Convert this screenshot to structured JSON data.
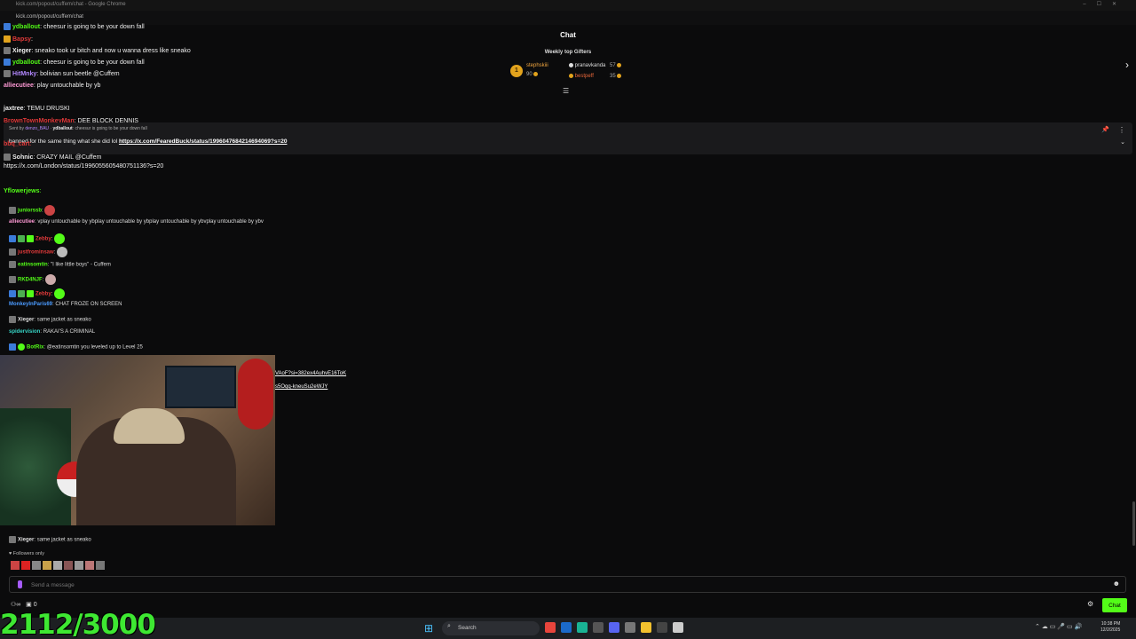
{
  "window": {
    "title": "kick.com/popout/cuffem/chat - Google Chrome",
    "url": "kick.com/popout/cuffem/chat"
  },
  "header": {
    "title": "Chat",
    "gifters_title": "Weekly top Gifters",
    "gifters": [
      {
        "rank": "1",
        "name": "stephskiii",
        "count": "90"
      },
      {
        "name": "pranavkanda",
        "count": "57"
      },
      {
        "name": "bestpeff",
        "count": "35"
      }
    ]
  },
  "overlay_messages": [
    {
      "user": "ydballout",
      "text": "cheesur is going to be your down fall",
      "color": "#53fc18"
    },
    {
      "user": "Bapsy",
      "text": "",
      "color": "#e23a3a"
    },
    {
      "user": "Xieger",
      "text": "sneako took ur bitch and now u wanna dress like sneako",
      "color": "#e8e8e8"
    },
    {
      "user": "ydballout",
      "text": "cheesur is going to be your down fall",
      "color": "#53fc18"
    },
    {
      "user": "HitMnky",
      "text": "bolivian sun beetle @Cuffem",
      "color": "#b388ff"
    },
    {
      "user": "alliecutiee",
      "text": "play untouchable by yb",
      "color": "#ff9ad5"
    },
    {
      "user": "jaxtree",
      "text": "TEMU DRUSKI",
      "color": "#e8e8e8"
    },
    {
      "user": "BrownTownMonkeyMan",
      "text": "DEE BLOCK DENNIS",
      "color": "#e23a3a"
    },
    {
      "user": "ydballout",
      "text": "cheesur is going to be your down fall",
      "color": "#53fc18"
    },
    {
      "user": "bbq_cart",
      "text": "",
      "color": "#e23a3a"
    },
    {
      "user": "Sohnic",
      "text": "CRAZY MAIL @Cuffem",
      "color": "#e8e8e8"
    },
    {
      "user": "",
      "text": "https://x.com/London/status/1996055605480751136?s=20",
      "color": "#e8e8e8"
    },
    {
      "user": "Yflowerjews",
      "text": "",
      "color": "#53fc18"
    }
  ],
  "pinned": {
    "sent_by": "Sent by",
    "sender": "denzo_BAU",
    "text": "banned for the same thing what she did lol",
    "link": "https://x.com/FearedBuck/status/1996047684214694069?s=20"
  },
  "chat_messages": [
    {
      "user": "juniorssb",
      "text": "",
      "color": "#53fc18"
    },
    {
      "user": "alliecutiee",
      "text": "vplay untouchable by ybplay untouchable by ybplay untouchable by ybvplay untouchable by ybv",
      "color": "#ff9ad5"
    },
    {
      "user": "Zebby",
      "text": "",
      "color": "#e23a3a"
    },
    {
      "user": "justfrominsaw",
      "text": "",
      "color": "#e23a3a"
    },
    {
      "user": "eatinsomtin",
      "text": "\"I like little boys\" - Cuffem",
      "color": "#53fc18"
    },
    {
      "user": "RKD4NJF",
      "text": "",
      "color": "#53fc18"
    },
    {
      "user": "Zebby",
      "text": "",
      "color": "#e23a3a"
    },
    {
      "user": "MonkeyInParis69",
      "text": "CHAT FROZE ON SCREEN",
      "color": "#4b9bff"
    },
    {
      "user": "Xieger",
      "text": "same jacket as sneako",
      "color": "#e8e8e8"
    },
    {
      "user": "spidervision",
      "text": "RAKAI'S A CRIMINAL",
      "color": "#36d3c4"
    },
    {
      "user": "BotRix",
      "text": "@eatinsomtin you leveled up to Level 25",
      "color": "#53fc18"
    }
  ],
  "cam_links": [
    "VAoF?si=382ex4AuhvE16ToK",
    "s5Oqq-kneuSu2eWJY"
  ],
  "after_cam": [
    {
      "user": "RKD4NJF",
      "text": "",
      "color": "#53fc18"
    },
    {
      "user": "Xieger",
      "text": "same jacket as sneako",
      "color": "#e8e8e8"
    }
  ],
  "followers_only": "Followers only",
  "input": {
    "placeholder": "Send a message"
  },
  "bottom": {
    "count_a": "0",
    "chat_button": "Chat"
  },
  "counter": "2112/3000",
  "taskbar": {
    "search": "Search",
    "time": "10:38 PM",
    "date": "12/2/2025"
  },
  "colors": {
    "accent": "#53fc18",
    "background": "#0b0b0c",
    "medal": "#e2a31d"
  }
}
